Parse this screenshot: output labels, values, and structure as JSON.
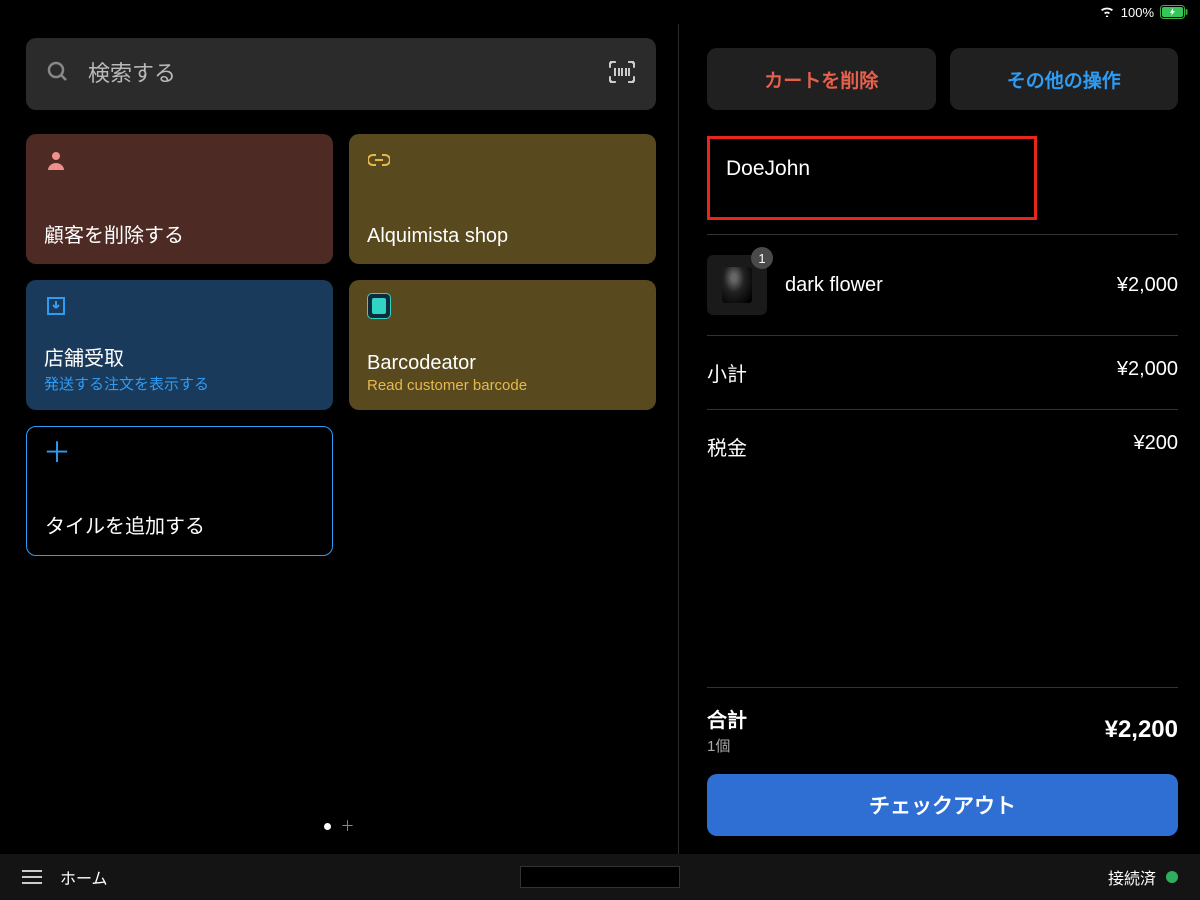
{
  "status_bar": {
    "battery_text": "100%"
  },
  "search": {
    "placeholder": "検索する"
  },
  "tiles": {
    "remove_customer": {
      "title": "顧客を削除する"
    },
    "alquimista": {
      "title": "Alquimista shop"
    },
    "pickup": {
      "title": "店舗受取",
      "sub": "発送する注文を表示する"
    },
    "barcodeator": {
      "title": "Barcodeator",
      "sub": "Read customer barcode"
    },
    "add_tile": {
      "title": "タイルを追加する"
    }
  },
  "cart": {
    "delete_btn": "カートを削除",
    "more_btn": "その他の操作",
    "customer_name": "DoeJohn",
    "items": [
      {
        "qty": "1",
        "name": "dark flower",
        "price": "¥2,000"
      }
    ],
    "subtotal_label": "小計",
    "subtotal_value": "¥2,000",
    "tax_label": "税金",
    "tax_value": "¥200",
    "total_label": "合計",
    "total_sub": "1個",
    "total_value": "¥2,200",
    "checkout_btn": "チェックアウト"
  },
  "bottom": {
    "home_label": "ホーム",
    "connection_label": "接続済"
  }
}
